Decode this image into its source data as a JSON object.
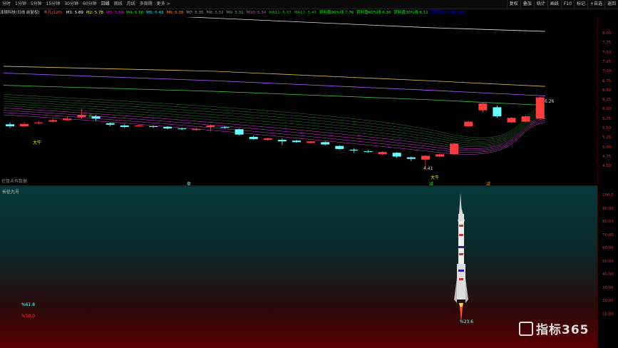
{
  "toolbar": {
    "tabs": [
      "分时",
      "1分钟",
      "5分钟",
      "15分钟",
      "30分钟",
      "60分钟",
      "日线",
      "周线",
      "月线",
      "多周期",
      "更多 >"
    ],
    "active_tab": "日线",
    "right_buttons": [
      "复权",
      "叠加",
      "统计",
      "画线",
      "F10",
      "标记",
      "+自选",
      "返回"
    ]
  },
  "title_bar": {
    "stock": "泽璟科技(日线 前复权)",
    "indicator": "丰儿(120)",
    "ma_values": [
      "M1: 5.89",
      "M2: 5.78",
      "M3: 5.59",
      "M4: 5.50",
      "M5: 5.43",
      "M6: 5.38",
      "M7: 5.35",
      "M8: 5.32",
      "M9: 5.31",
      "M10: 5.34",
      "MA11: 5.37",
      "MA12: 5.43"
    ],
    "extra": [
      "获利盘90%线 7.76",
      "获利盘60%线 6.36",
      "获利盘30%线 6.11",
      "获利盘10%线 5.87"
    ]
  },
  "price_axis": [
    "8.00",
    "7.75",
    "7.50",
    "7.25",
    "7.00",
    "6.75",
    "6.50",
    "6.25",
    "6.00",
    "5.75",
    "5.50",
    "5.25",
    "5.00",
    "4.75",
    "4.50"
  ],
  "annotations": {
    "high_price": "6.26",
    "low_price": "4.41",
    "big_bull_1": "大牛",
    "big_bull_2": "大牛",
    "marker_buy": "买",
    "marker_sell": "卖",
    "bottom_left": "控盘未有数据",
    "vol_marks": [
      "卖",
      "减",
      "减"
    ]
  },
  "lower_panel": {
    "title": "长征九号",
    "axis": [
      "100.0",
      "90.00",
      "80.00",
      "70.00",
      "60.00",
      "50.00",
      "40.00",
      "30.00",
      "20.00",
      "10.00"
    ],
    "label_cyan": "%61.8",
    "label_red": "%50.0",
    "rocket_value": "%23.6"
  },
  "watermark": "指标365",
  "colors": {
    "up": "#ff3b3b",
    "down": "#6ff",
    "accent": "#ff3b3b"
  },
  "chart_data": {
    "type": "line",
    "candles": [
      {
        "o": 5.55,
        "c": 5.5,
        "h": 5.6,
        "l": 5.45
      },
      {
        "o": 5.5,
        "c": 5.56,
        "h": 5.62,
        "l": 5.48
      },
      {
        "o": 5.58,
        "c": 5.6,
        "h": 5.65,
        "l": 5.55
      },
      {
        "o": 5.62,
        "c": 5.66,
        "h": 5.7,
        "l": 5.6
      },
      {
        "o": 5.66,
        "c": 5.7,
        "h": 5.75,
        "l": 5.64
      },
      {
        "o": 5.74,
        "c": 5.8,
        "h": 5.95,
        "l": 5.7
      },
      {
        "o": 5.76,
        "c": 5.7,
        "h": 5.8,
        "l": 5.65
      },
      {
        "o": 5.58,
        "c": 5.54,
        "h": 5.6,
        "l": 5.5
      },
      {
        "o": 5.52,
        "c": 5.48,
        "h": 5.55,
        "l": 5.45
      },
      {
        "o": 5.5,
        "c": 5.52,
        "h": 5.55,
        "l": 5.48
      },
      {
        "o": 5.5,
        "c": 5.48,
        "h": 5.52,
        "l": 5.46
      },
      {
        "o": 5.48,
        "c": 5.44,
        "h": 5.5,
        "l": 5.42
      },
      {
        "o": 5.44,
        "c": 5.42,
        "h": 5.46,
        "l": 5.4
      },
      {
        "o": 5.4,
        "c": 5.43,
        "h": 5.46,
        "l": 5.38
      },
      {
        "o": 5.48,
        "c": 5.52,
        "h": 5.55,
        "l": 5.36
      },
      {
        "o": 5.48,
        "c": 5.46,
        "h": 5.5,
        "l": 5.44
      },
      {
        "o": 5.42,
        "c": 5.28,
        "h": 5.44,
        "l": 5.26
      },
      {
        "o": 5.22,
        "c": 5.16,
        "h": 5.25,
        "l": 5.14
      },
      {
        "o": 5.14,
        "c": 5.18,
        "h": 5.2,
        "l": 5.12
      },
      {
        "o": 5.14,
        "c": 5.1,
        "h": 5.18,
        "l": 5.0
      },
      {
        "o": 5.12,
        "c": 5.08,
        "h": 5.14,
        "l": 5.06
      },
      {
        "o": 5.06,
        "c": 5.1,
        "h": 5.12,
        "l": 5.04
      },
      {
        "o": 5.08,
        "c": 5.02,
        "h": 5.1,
        "l": 5.0
      },
      {
        "o": 4.98,
        "c": 4.9,
        "h": 5.0,
        "l": 4.88
      },
      {
        "o": 4.88,
        "c": 4.86,
        "h": 4.92,
        "l": 4.8
      },
      {
        "o": 4.84,
        "c": 4.82,
        "h": 4.88,
        "l": 4.8
      },
      {
        "o": 4.76,
        "c": 4.82,
        "h": 4.84,
        "l": 4.74
      },
      {
        "o": 4.8,
        "c": 4.7,
        "h": 4.82,
        "l": 4.66
      },
      {
        "o": 4.68,
        "c": 4.64,
        "h": 4.7,
        "l": 4.58
      },
      {
        "o": 4.62,
        "c": 4.72,
        "h": 4.74,
        "l": 4.41
      },
      {
        "o": 4.7,
        "c": 4.76,
        "h": 4.78,
        "l": 4.68
      },
      {
        "o": 4.76,
        "c": 5.04,
        "h": 5.06,
        "l": 4.74
      },
      {
        "o": 5.5,
        "c": 5.62,
        "h": 5.64,
        "l": 5.48
      },
      {
        "o": 5.92,
        "c": 6.1,
        "h": 6.12,
        "l": 5.86
      },
      {
        "o": 6.0,
        "c": 5.76,
        "h": 6.04,
        "l": 5.72
      },
      {
        "o": 5.6,
        "c": 5.72,
        "h": 5.74,
        "l": 5.58
      },
      {
        "o": 5.62,
        "c": 5.76,
        "h": 5.78,
        "l": 5.6
      },
      {
        "o": 5.7,
        "c": 6.26,
        "h": 6.28,
        "l": 5.68
      }
    ]
  }
}
